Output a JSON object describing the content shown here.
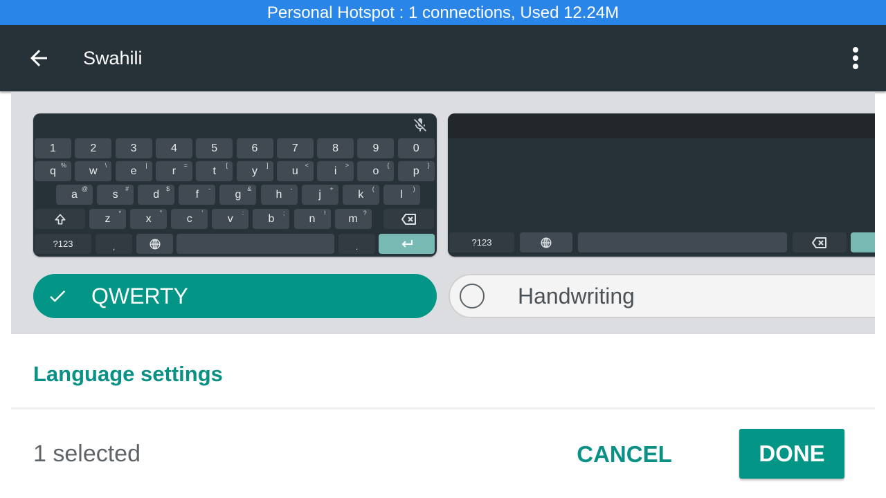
{
  "status_bar": {
    "text": "Personal Hotspot : 1 connections, Used 12.24M",
    "color": "#2986e8"
  },
  "toolbar": {
    "title": "Swahili",
    "back_icon": "arrow-left-icon",
    "more_icon": "more-vert-icon"
  },
  "keyboard_qwerty": {
    "mic_icon": "mic-off-icon",
    "rows": [
      [
        {
          "label": "1"
        },
        {
          "label": "2"
        },
        {
          "label": "3"
        },
        {
          "label": "4"
        },
        {
          "label": "5"
        },
        {
          "label": "6"
        },
        {
          "label": "7"
        },
        {
          "label": "8"
        },
        {
          "label": "9"
        },
        {
          "label": "0"
        }
      ],
      [
        {
          "label": "q",
          "hint": "%"
        },
        {
          "label": "w",
          "hint": "\\"
        },
        {
          "label": "e",
          "hint": "|"
        },
        {
          "label": "r",
          "hint": "="
        },
        {
          "label": "t",
          "hint": "["
        },
        {
          "label": "y",
          "hint": "]"
        },
        {
          "label": "u",
          "hint": "<"
        },
        {
          "label": "i",
          "hint": ">"
        },
        {
          "label": "o",
          "hint": "{"
        },
        {
          "label": "p",
          "hint": "}"
        }
      ],
      [
        {
          "label": "a",
          "hint": "@"
        },
        {
          "label": "s",
          "hint": "#"
        },
        {
          "label": "d",
          "hint": "$"
        },
        {
          "label": "f",
          "hint": "-"
        },
        {
          "label": "g",
          "hint": "&"
        },
        {
          "label": "h",
          "hint": "-"
        },
        {
          "label": "j",
          "hint": "+"
        },
        {
          "label": "k",
          "hint": "("
        },
        {
          "label": "l",
          "hint": ")"
        }
      ],
      [
        {
          "label": "z",
          "hint": "*"
        },
        {
          "label": "x",
          "hint": "\""
        },
        {
          "label": "c",
          "hint": "'"
        },
        {
          "label": "v",
          "hint": ":"
        },
        {
          "label": "b",
          "hint": ";"
        },
        {
          "label": "n",
          "hint": "!"
        },
        {
          "label": "m",
          "hint": "?"
        }
      ]
    ],
    "shift_icon": "shift-icon",
    "backspace_icon": "backspace-icon",
    "symbols_label": "?123",
    "comma_label": ",",
    "globe_icon": "globe-icon",
    "period_label": ".",
    "enter_icon": "enter-icon",
    "enter_color": "#79b9b4"
  },
  "keyboard_handwriting": {
    "symbols_label": "?123",
    "globe_icon": "globe-icon",
    "backspace_icon": "backspace-icon"
  },
  "layouts": [
    {
      "label": "QWERTY",
      "selected": true,
      "icon": "check-icon"
    },
    {
      "label": "Handwriting",
      "selected": false,
      "icon": "radio-unchecked-icon"
    }
  ],
  "language_settings_label": "Language settings",
  "footer": {
    "selected_text": "1 selected",
    "cancel_label": "CANCEL",
    "done_label": "DONE"
  },
  "colors": {
    "accent": "#039686",
    "toolbar": "#263238",
    "keyboard_bg": "#263238"
  }
}
